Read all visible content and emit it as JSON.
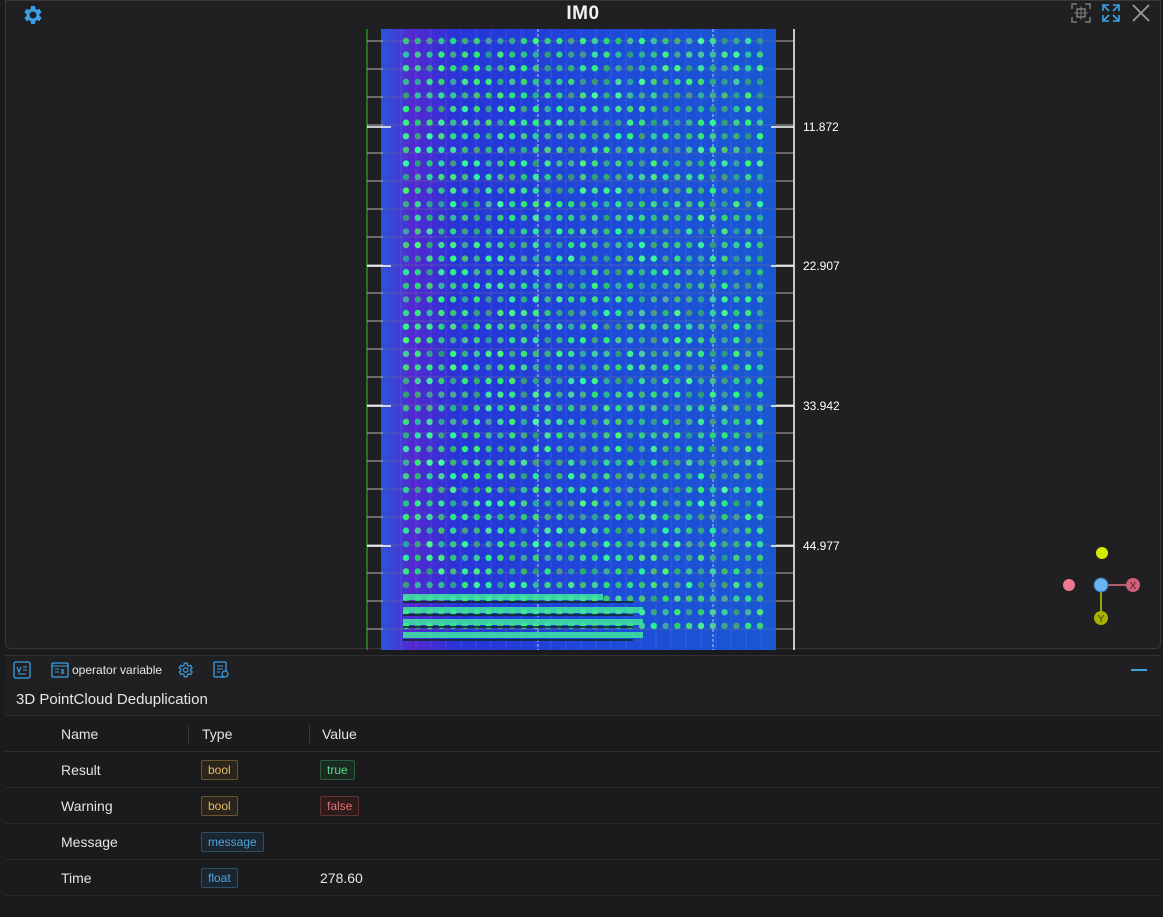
{
  "viewer": {
    "title": "IM0",
    "icons": [
      "gear-icon",
      "fit-view-icon",
      "expand-icon",
      "close-icon"
    ],
    "scale_ticks": [
      "11.872",
      "22.907",
      "33.942",
      "44.977"
    ],
    "axes": {
      "x_label": "X",
      "y_label": "Y"
    },
    "colors": {
      "point_blue": "#1f3bd8",
      "point_green": "#3ee87a",
      "axis_x": "#e07080",
      "axis_y": "#b8d400",
      "axis_origin": "#6ab3f0"
    }
  },
  "toolbar": {
    "buttons": [
      {
        "icon": "var-view-icon"
      },
      {
        "icon": "variable-list-icon",
        "label": "operator variable"
      },
      {
        "icon": "settings-gear-icon"
      },
      {
        "icon": "report-icon"
      }
    ]
  },
  "panel": {
    "title": "3D PointCloud Deduplication",
    "columns": {
      "name": "Name",
      "type": "Type",
      "value": "Value"
    },
    "rows": [
      {
        "name": "Result",
        "type": "bool",
        "value": "true"
      },
      {
        "name": "Warning",
        "type": "bool",
        "value": "false"
      },
      {
        "name": "Message",
        "type": "message",
        "value": ""
      },
      {
        "name": "Time",
        "type": "float",
        "value": "278.60"
      }
    ]
  }
}
